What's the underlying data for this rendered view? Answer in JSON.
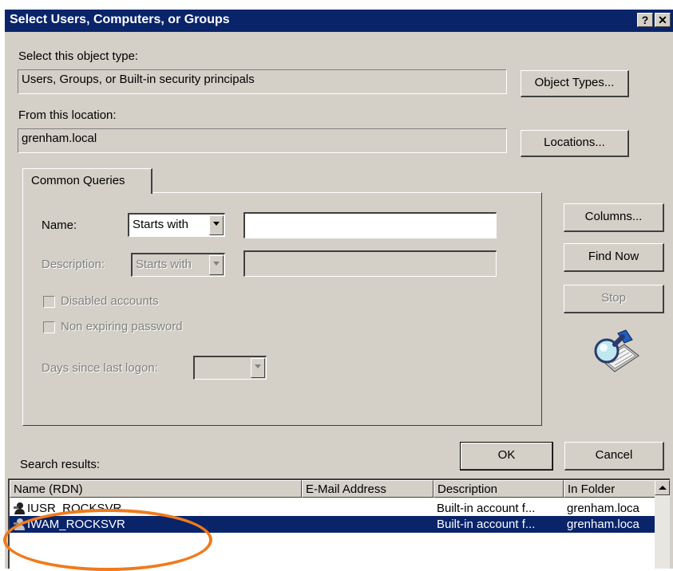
{
  "window": {
    "title": "Select Users, Computers, or Groups",
    "help_glyph": "?",
    "close_glyph": "✕"
  },
  "object_type": {
    "label": "Select this object type:",
    "value": "Users, Groups, or Built-in security principals",
    "button": "Object Types..."
  },
  "location": {
    "label": "From this location:",
    "value": "grenham.local",
    "button": "Locations..."
  },
  "tabs": [
    "Common Queries"
  ],
  "query": {
    "name_label": "Name:",
    "name_mode": "Starts with",
    "name_value": "",
    "description_label": "Description:",
    "description_mode": "Starts with",
    "description_value": "",
    "disabled_accounts": "Disabled accounts",
    "non_expiring_password": "Non expiring password",
    "days_label": "Days since last logon:",
    "days_value": ""
  },
  "side_buttons": {
    "columns": "Columns...",
    "find_now": "Find Now",
    "stop": "Stop"
  },
  "dialog_buttons": {
    "ok": "OK",
    "cancel": "Cancel"
  },
  "results": {
    "label": "Search results:",
    "columns": [
      "Name (RDN)",
      "E-Mail Address",
      "Description",
      "In Folder"
    ],
    "rows": [
      {
        "name": "IUSR_ROCKSVR",
        "email": "",
        "description": "Built-in account f...",
        "folder": "grenham.loca"
      },
      {
        "name": "IWAM_ROCKSVR",
        "email": "",
        "description": "Built-in account f...",
        "folder": "grenham.loca",
        "selected": true
      }
    ]
  },
  "colors": {
    "titlebar": "#0a246a",
    "dialog_face": "#d4d0c8",
    "highlight": "#f07a1c"
  }
}
